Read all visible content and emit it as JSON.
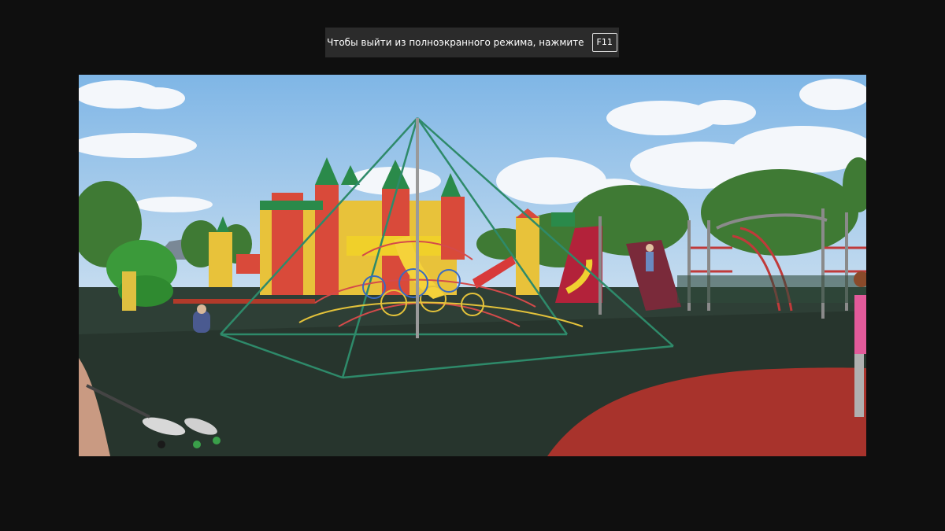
{
  "fullscreen_notice": {
    "message": "Чтобы выйти из полноэкранного режима, нажмите",
    "key": "F11"
  },
  "image": {
    "icon": "photo-icon",
    "subject": "playground"
  },
  "colors": {
    "background": "#0f0f0f",
    "banner": "#2b2b2b",
    "sky": "#8fc1ea",
    "ground_dark": "#2e3f36",
    "ground_red": "#a8332c"
  }
}
